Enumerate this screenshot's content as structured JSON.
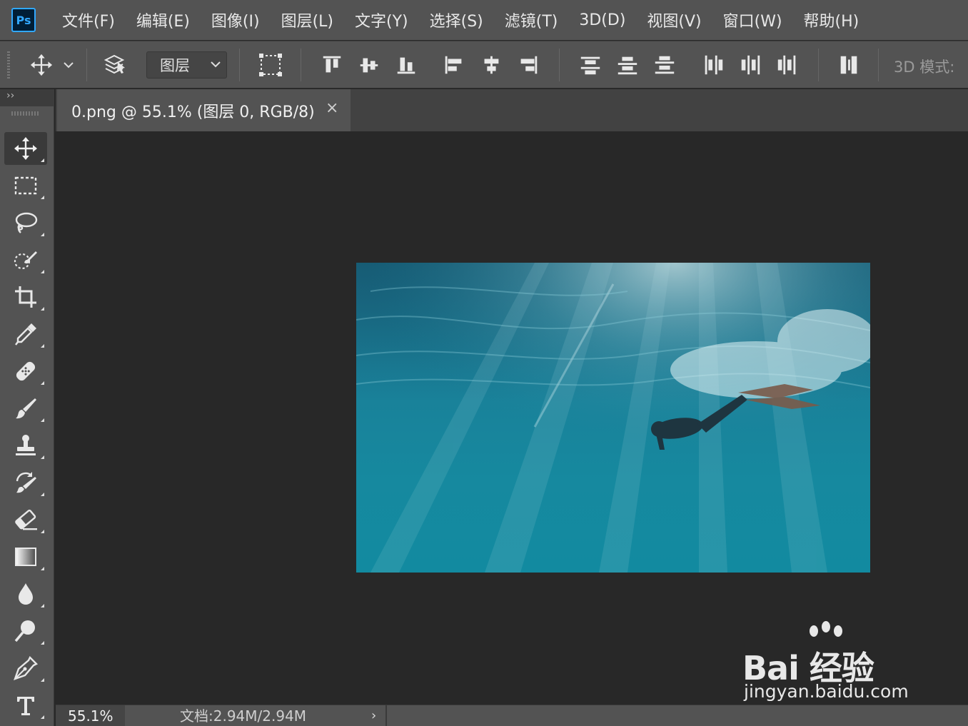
{
  "app": {
    "logo": "Ps"
  },
  "menu": [
    "文件(F)",
    "编辑(E)",
    "图像(I)",
    "图层(L)",
    "文字(Y)",
    "选择(S)",
    "滤镜(T)",
    "3D(D)",
    "视图(V)",
    "窗口(W)",
    "帮助(H)"
  ],
  "options": {
    "auto_select_value": "图层",
    "mode_3d_label": "3D 模式:"
  },
  "panel": {
    "collapse_glyph": "››"
  },
  "document": {
    "tab_title": "0.png @ 55.1% (图层 0, RGB/8)",
    "close_glyph": "×"
  },
  "status": {
    "zoom": "55.1%",
    "doc_size": "文档:2.94M/2.94M",
    "arrow": "›"
  },
  "tools": [
    "move-tool",
    "marquee-tool",
    "lasso-tool",
    "quick-selection-tool",
    "crop-tool",
    "eyedropper-tool",
    "healing-brush-tool",
    "brush-tool",
    "clone-stamp-tool",
    "history-brush-tool",
    "eraser-tool",
    "gradient-tool",
    "blur-tool",
    "dodge-tool",
    "pen-tool",
    "type-tool"
  ],
  "watermark": {
    "brand": "Bai 经验",
    "url": "jingyan.baidu.com"
  },
  "colors": {
    "panel": "#535353",
    "canvas": "#282828",
    "accent": "#31a8ff"
  }
}
